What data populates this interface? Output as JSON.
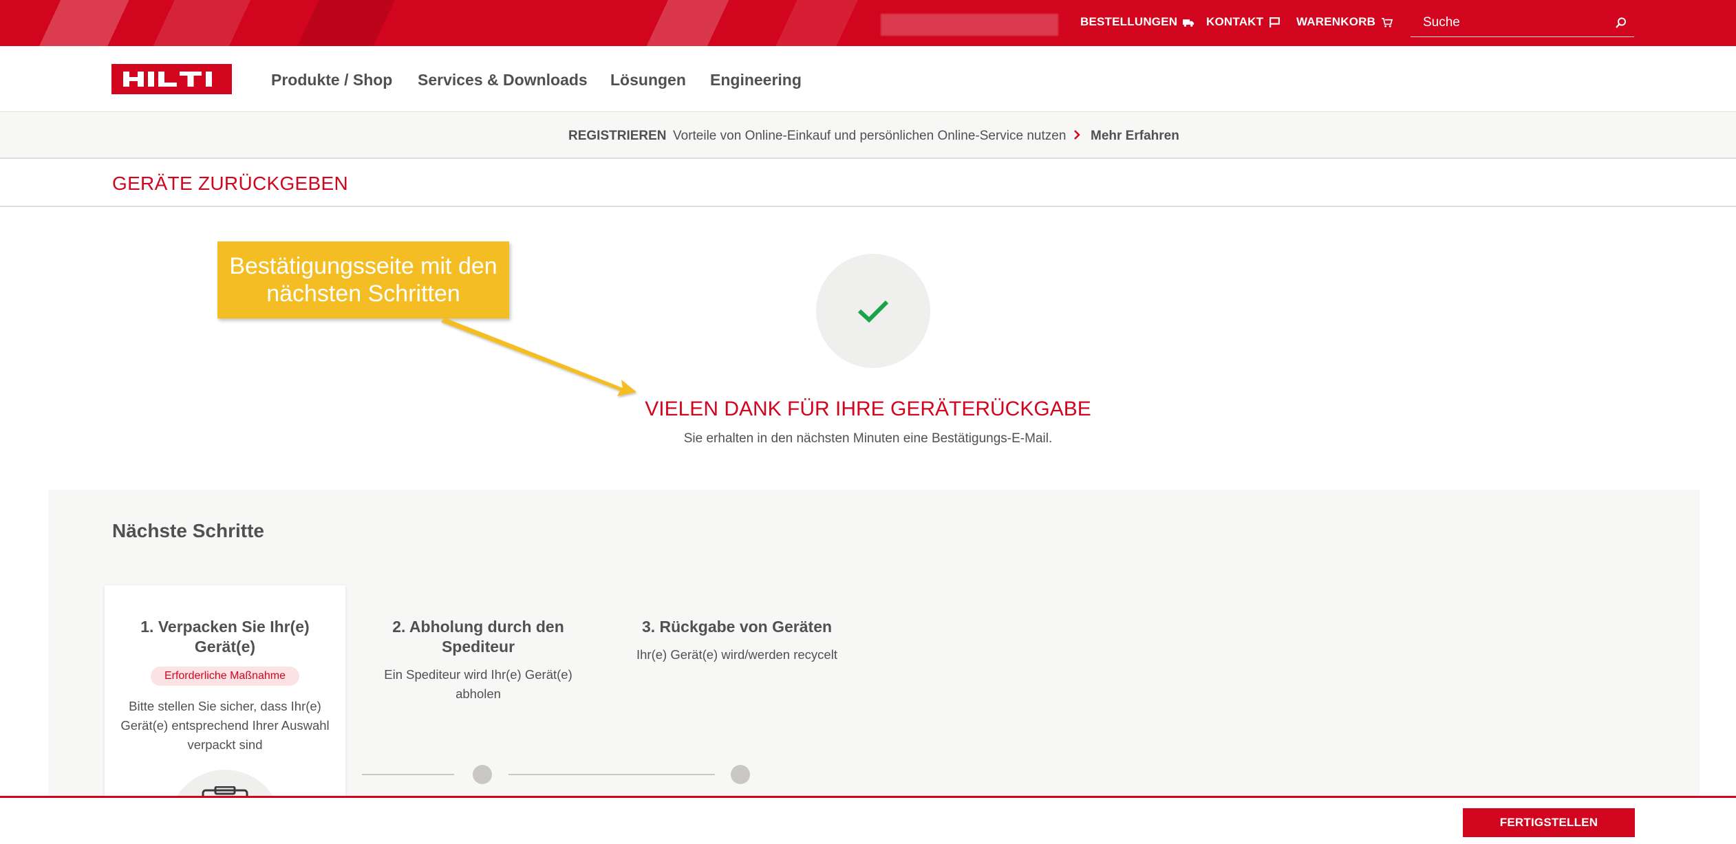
{
  "topbar": {
    "links": [
      {
        "label": "BESTELLUNGEN",
        "icon": "truck-icon"
      },
      {
        "label": "KONTAKT",
        "icon": "chat-flag-icon"
      },
      {
        "label": "WARENKORB",
        "icon": "cart-icon"
      }
    ],
    "search": {
      "placeholder": "Suche",
      "icon": "search-icon"
    }
  },
  "header": {
    "logo_text": "HILTI",
    "nav": [
      "Produkte / Shop",
      "Services & Downloads",
      "Lösungen",
      "Engineering"
    ]
  },
  "register_bar": {
    "strong": "REGISTRIEREN",
    "text": "Vorteile von Online-Einkauf und persönlichen Online-Service nutzen",
    "more": "Mehr Erfahren"
  },
  "page": {
    "title": "GERÄTE ZURÜCKGEBEN"
  },
  "callout": {
    "text": "Bestätigungsseite mit den nächsten Schritten"
  },
  "confirmation": {
    "icon": "checkmark-icon",
    "title": "VIELEN DANK FÜR IHRE GERÄTERÜCKGABE",
    "subtitle": "Sie erhalten in den nächsten Minuten eine Bestätigungs-E-Mail."
  },
  "next_steps": {
    "title": "Nächste Schritte",
    "steps": [
      {
        "title": "1. Verpacken Sie Ihr(e) Gerät(e)",
        "badge": "Erforderliche Maßnahme",
        "text": "Bitte stellen Sie sicher, dass Ihr(e) Gerät(e) entsprechend Ihrer Auswahl verpackt sind",
        "icon": "package-box-icon"
      },
      {
        "title": "2. Abholung durch den Spediteur",
        "text": "Ein Spediteur wird Ihr(e) Gerät(e) abholen"
      },
      {
        "title": "3. Rückgabe von Geräten",
        "text": "Ihr(e) Gerät(e) wird/werden recycelt"
      }
    ]
  },
  "footer": {
    "finish_label": "FERTIGSTELLEN"
  },
  "colors": {
    "brand_red": "#d2051e",
    "callout_yellow": "#f4bd23",
    "check_green": "#1aa34a"
  }
}
